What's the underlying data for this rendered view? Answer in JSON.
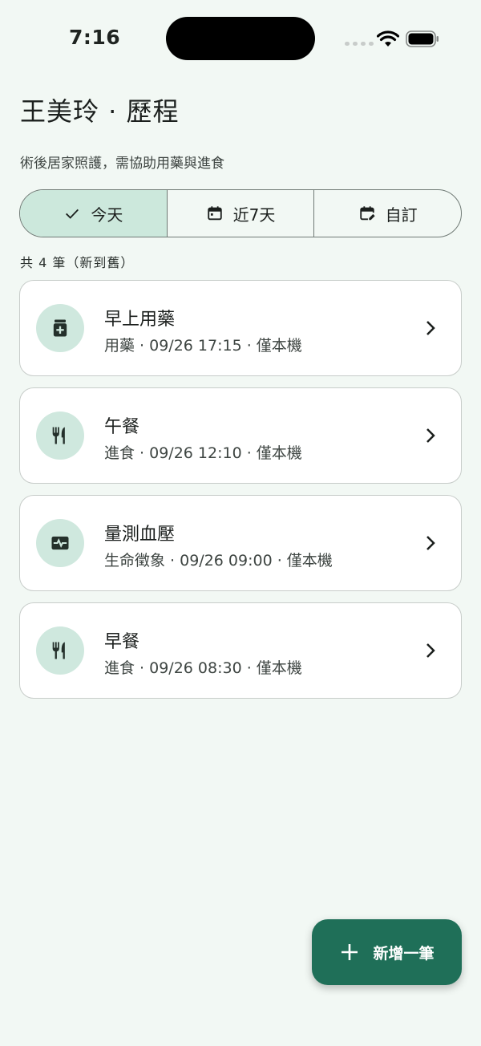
{
  "status_bar": {
    "time": "7:16"
  },
  "header": {
    "title": "王美玲 · 歷程",
    "subtitle": "術後居家照護，需協助用藥與進食"
  },
  "filter": {
    "today": "今天",
    "last7": "近7天",
    "custom": "自訂",
    "selected": "今天"
  },
  "count_text": "共 4 筆（新到舊）",
  "records": [
    {
      "title": "早上用藥",
      "meta": "用藥 · 09/26 17:15 · 僅本機",
      "icon": "medicine-icon"
    },
    {
      "title": "午餐",
      "meta": "進食 · 09/26 12:10 · 僅本機",
      "icon": "utensils-icon"
    },
    {
      "title": "量測血壓",
      "meta": "生命徵象 · 09/26 09:00 · 僅本機",
      "icon": "vitals-icon"
    },
    {
      "title": "早餐",
      "meta": "進食 · 09/26 08:30 · 僅本機",
      "icon": "utensils-icon"
    }
  ],
  "fab": {
    "label": "新增一筆"
  },
  "colors": {
    "background": "#f2f8f4",
    "accent": "#1f6f58",
    "selected_segment": "#cce8dc",
    "icon_circle": "#cfe8de"
  }
}
